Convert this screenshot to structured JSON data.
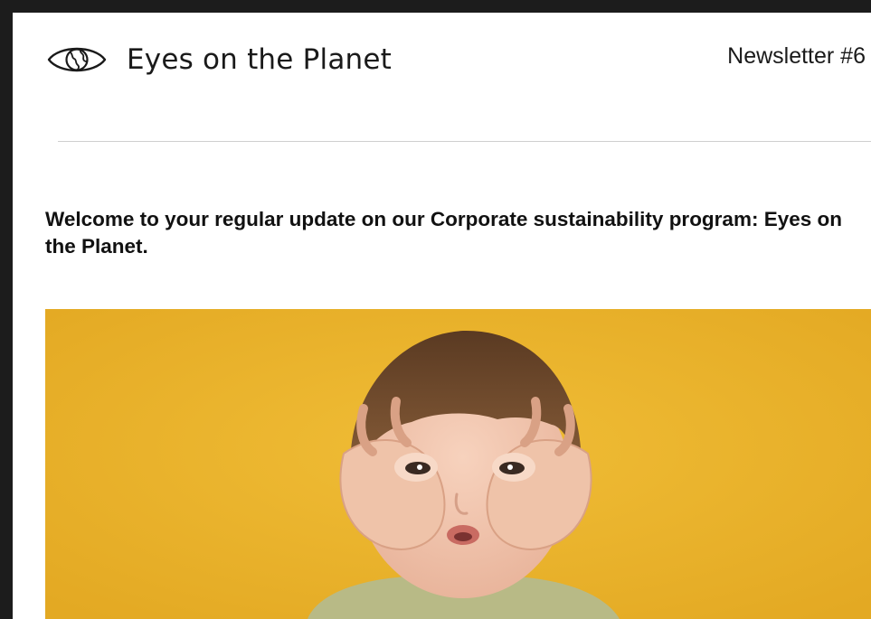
{
  "header": {
    "brand_icon": "eye-globe-icon",
    "brand_name": "Eyes on the Planet",
    "issue_label": "Newsletter #6"
  },
  "intro": {
    "text": "Welcome to your regular update on our Corporate sustainability program: Eyes on the Planet."
  },
  "hero": {
    "image": "child-making-binoculars-with-hands-photo",
    "background_color": "#e8b22c"
  },
  "colors": {
    "frame": "#1c1c1c",
    "page": "#ffffff",
    "text": "#111111",
    "divider": "#cfcfcf"
  }
}
